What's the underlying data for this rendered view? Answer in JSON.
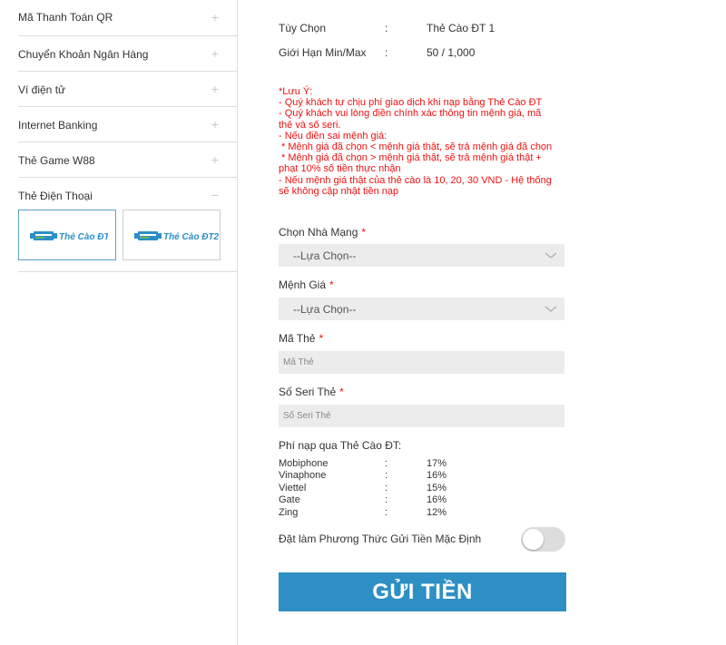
{
  "sidebar": {
    "items": [
      {
        "label": "Mã Thanh Toán QR",
        "toggle": "+"
      },
      {
        "label": "Chuyển Khoản Ngân Hàng",
        "toggle": "+"
      },
      {
        "label": "Ví điện tử",
        "toggle": "+"
      },
      {
        "label": "Internet Banking",
        "toggle": "+"
      },
      {
        "label": "Thẻ Game W88",
        "toggle": "+"
      },
      {
        "label": "Thẻ Điện Thoại",
        "toggle": "−"
      }
    ],
    "cards": [
      {
        "label": "Thẻ Cào ĐT",
        "selected": true
      },
      {
        "label": "Thẻ Cào ĐT2",
        "selected": false
      }
    ]
  },
  "info": {
    "option_label": "Tùy Chọn",
    "option_value": "Thẻ Cào ĐT 1",
    "limit_label": "Giới Hạn Min/Max",
    "limit_value": "50 / 1,000",
    "colon": ":"
  },
  "notes": [
    "*Lưu Ý:",
    "- Quý khách tự chịu phí giao dịch khi nạp bằng Thẻ Cào ĐT",
    "- Quý khách vui lòng điền chính xác thông tin mệnh giá, mã",
    "thẻ và số seri.",
    "- Nếu điền sai mệnh giá:",
    " * Mệnh giá đã chọn < mệnh giá thật, sẽ trả mệnh giá đã chọn",
    " * Mệnh giá đã chọn > mệnh giá thật, sẽ trả mệnh giá thật +",
    "phạt 10% số tiền thực nhận",
    "- Nếu mệnh giá thật của thẻ cào là 10, 20, 30 VND - Hệ thống",
    "sẽ không cập nhật tiền nạp"
  ],
  "form": {
    "network_label": "Chọn Nhà Mạng",
    "network_value": "--Lựa Chọn--",
    "denom_label": "Mệnh Giá",
    "denom_value": "--Lựa Chọn--",
    "code_label": "Mã Thẻ",
    "code_placeholder": "Mã Thẻ",
    "serial_label": "Số Seri Thẻ",
    "serial_placeholder": "Số Seri Thẻ",
    "required_mark": "*"
  },
  "fees": {
    "title": "Phí nạp qua Thẻ Cào ĐT:",
    "rows": [
      {
        "name": "Mobiphone",
        "pct": "17%"
      },
      {
        "name": "Vinaphone",
        "pct": "16%"
      },
      {
        "name": "Viettel",
        "pct": "15%"
      },
      {
        "name": "Gate",
        "pct": "16%"
      },
      {
        "name": "Zing",
        "pct": "12%"
      }
    ]
  },
  "default_method_label": "Đặt làm Phương Thức Gửi Tiền Mặc Định",
  "default_method_on": false,
  "submit_label": "GỬI TIỀN",
  "colors": {
    "accent": "#2e8fc4",
    "warning": "#e11111"
  }
}
